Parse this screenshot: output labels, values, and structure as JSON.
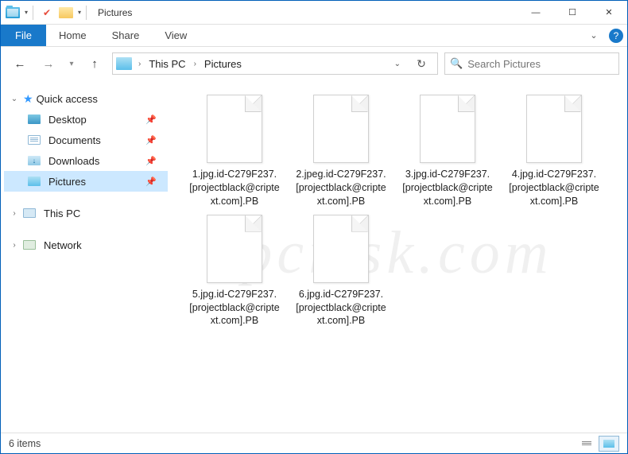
{
  "window": {
    "title": "Pictures",
    "minimize_glyph": "—",
    "maximize_glyph": "☐",
    "close_glyph": "✕"
  },
  "ribbon": {
    "file": "File",
    "tabs": [
      "Home",
      "Share",
      "View"
    ],
    "expand_glyph": "⌄",
    "help_glyph": "?"
  },
  "nav": {
    "back_glyph": "←",
    "forward_glyph": "→",
    "dropdown_glyph": "▾",
    "up_glyph": "↑",
    "refresh_glyph": "↻"
  },
  "address": {
    "segments": [
      "This PC",
      "Pictures"
    ],
    "chev_glyph": "›",
    "drop_glyph": "⌄"
  },
  "search": {
    "placeholder": "Search Pictures",
    "icon_glyph": "🔍"
  },
  "sidebar": {
    "quick_access": {
      "label": "Quick access",
      "chev": "⌄",
      "star": "★"
    },
    "items": [
      {
        "label": "Desktop",
        "pin": "📌"
      },
      {
        "label": "Documents",
        "pin": "📌"
      },
      {
        "label": "Downloads",
        "pin": "📌"
      },
      {
        "label": "Pictures",
        "pin": "📌"
      }
    ],
    "this_pc": {
      "label": "This PC",
      "chev": "›"
    },
    "network": {
      "label": "Network",
      "chev": "›"
    }
  },
  "files": [
    {
      "name": "1.jpg.id-C279F237.[projectblack@criptext.com].PB"
    },
    {
      "name": "2.jpeg.id-C279F237.[projectblack@criptext.com].PB"
    },
    {
      "name": "3.jpg.id-C279F237.[projectblack@criptext.com].PB"
    },
    {
      "name": "4.jpg.id-C279F237.[projectblack@criptext.com].PB"
    },
    {
      "name": "5.jpg.id-C279F237.[projectblack@criptext.com].PB"
    },
    {
      "name": "6.jpg.id-C279F237.[projectblack@criptext.com].PB"
    }
  ],
  "status": {
    "count_text": "6 items"
  },
  "watermark": "pcrisk.com"
}
